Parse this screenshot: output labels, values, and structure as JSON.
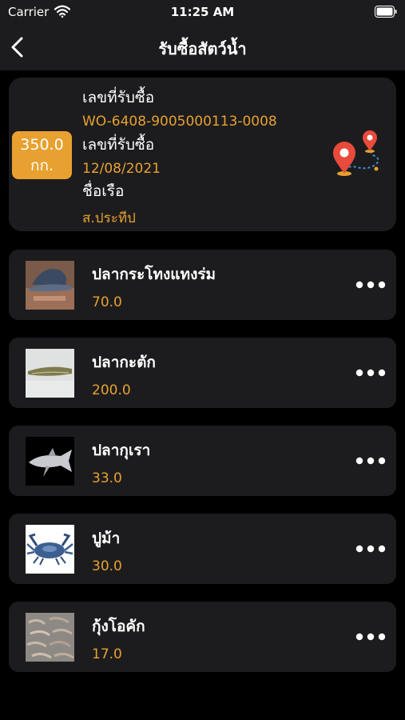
{
  "status": {
    "carrier": "Carrier",
    "time": "11:25 AM"
  },
  "nav": {
    "title": "รับซื้อสัตว์น้ำ"
  },
  "summary": {
    "weight_value": "350.0",
    "weight_unit": "กก.",
    "purchase_no_label": "เลขที่รับซื้อ",
    "purchase_no": "WO-6408-9005000113-0008",
    "date_label": "เลขที่รับซื้อ",
    "date": "12/08/2021",
    "boat_label": "ชื่อเรือ",
    "boat_name": "ส.ประทีป"
  },
  "items": [
    {
      "name": "ปลากระโทงแทงร่ม",
      "qty": "70.0",
      "thumb": "sailfish"
    },
    {
      "name": "ปลากะตัก",
      "qty": "200.0",
      "thumb": "anchovy"
    },
    {
      "name": "ปลากุเรา",
      "qty": "33.0",
      "thumb": "threadfin"
    },
    {
      "name": "ปูม้า",
      "qty": "30.0",
      "thumb": "blue-crab"
    },
    {
      "name": "กุ้งโอคัก",
      "qty": "17.0",
      "thumb": "shrimp"
    }
  ],
  "colors": {
    "accent": "#e8a130",
    "card": "#1c1c1e",
    "background": "#000000",
    "pin": "#e84a3c"
  }
}
